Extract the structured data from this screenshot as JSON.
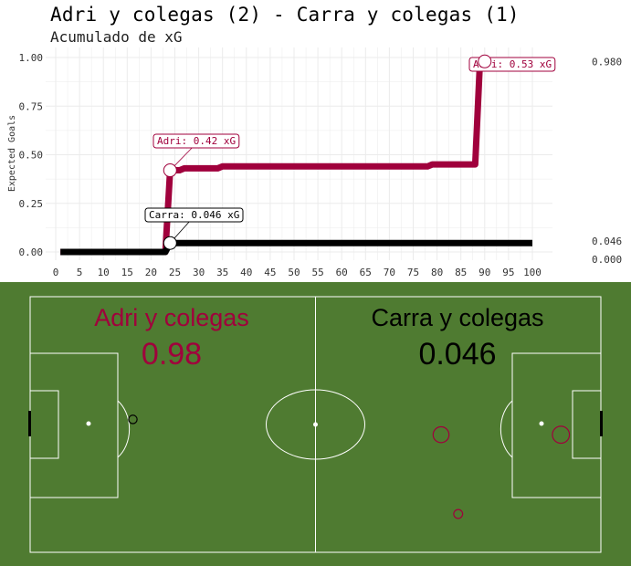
{
  "title": "Adri y colegas (2) - Carra y colegas (1)",
  "subtitle": "Acumulado de xG",
  "colors": {
    "home": "#a0003c",
    "away": "#000000",
    "pitch": "#4f7b31",
    "pitch_lines": "#ffffff",
    "grid": "#ebebeb"
  },
  "chart_data": {
    "type": "line",
    "ylabel": "Expected Goals",
    "xlabel": "",
    "xlim": [
      0,
      100
    ],
    "ylim": [
      0,
      1
    ],
    "x_ticks": [
      0,
      5,
      10,
      15,
      20,
      25,
      30,
      35,
      40,
      45,
      50,
      55,
      60,
      65,
      70,
      75,
      80,
      85,
      90,
      95,
      100
    ],
    "y_ticks": [
      "0.00",
      "0.25",
      "0.50",
      "0.75",
      "1.00"
    ],
    "y_tick_values": [
      0,
      0.25,
      0.5,
      0.75,
      1.0
    ],
    "grid": true,
    "series": [
      {
        "name": "Adri",
        "color": "#a0003c",
        "points": [
          [
            1,
            0.0
          ],
          [
            23,
            0.0
          ],
          [
            24,
            0.42
          ],
          [
            26,
            0.42
          ],
          [
            27,
            0.43
          ],
          [
            34,
            0.43
          ],
          [
            35,
            0.44
          ],
          [
            78,
            0.44
          ],
          [
            79,
            0.45
          ],
          [
            88,
            0.45
          ],
          [
            89,
            0.98
          ],
          [
            100,
            0.98
          ]
        ]
      },
      {
        "name": "Carra",
        "color": "#000000",
        "points": [
          [
            1,
            0.0
          ],
          [
            23,
            0.0
          ],
          [
            24,
            0.046
          ],
          [
            100,
            0.046
          ]
        ]
      }
    ],
    "annotations": [
      {
        "series": "Adri",
        "label": "Adri: 0.42 xG",
        "x": 24,
        "y": 0.42,
        "color": "#a0003c"
      },
      {
        "series": "Adri",
        "label": "Adri: 0.53 xG",
        "x": 90,
        "y": 0.98,
        "color": "#a0003c"
      },
      {
        "series": "Carra",
        "label": "Carra: 0.046 xG",
        "x": 24,
        "y": 0.046,
        "color": "#000000"
      }
    ],
    "end_labels": [
      {
        "label": "0.980",
        "y": 0.98
      },
      {
        "label": "0.046",
        "y": 0.046
      },
      {
        "label": "0.000",
        "y": 0.0
      }
    ]
  },
  "pitch": {
    "home_team": "Adri y colegas",
    "home_xg": "0.98",
    "away_team": "Carra y colegas",
    "away_xg": "0.046",
    "shots": [
      {
        "team": "home",
        "x": 18,
        "y": 52,
        "xg": 0.02,
        "goal": false
      },
      {
        "team": "home",
        "x": 72,
        "y": 46,
        "xg": 0.42,
        "goal": true
      },
      {
        "team": "home",
        "x": 93,
        "y": 46,
        "xg": 0.53,
        "goal": true
      },
      {
        "team": "home",
        "x": 75,
        "y": 15,
        "xg": 0.03,
        "goal": false
      }
    ]
  }
}
